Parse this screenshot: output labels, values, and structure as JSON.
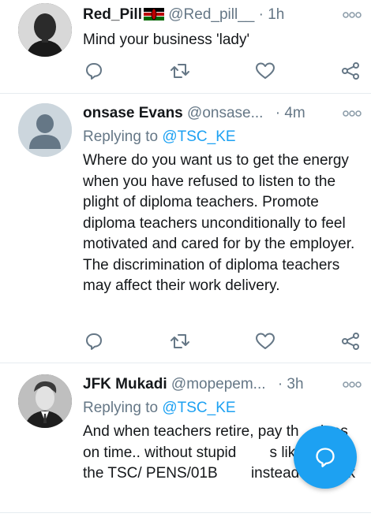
{
  "tweets": [
    {
      "name": "Red_Pill",
      "handle": "@Red_pill__",
      "dot": "·",
      "time": "1h",
      "text": "Mind your business 'lady'",
      "avatar": "man-portrait-bw",
      "flag": "kenya-flag"
    },
    {
      "name": "onsase Evans",
      "handle": "@onsase...",
      "dot": "·",
      "time": "4m",
      "reply_prefix": "Replying to",
      "reply_to": "@TSC_KE",
      "text": "Where do you want us to get the energy when you have refused to listen to the plight of diploma teachers. Promote diploma teachers unconditionally to feel motivated and cared for by the employer. The discrimination of diploma teachers may affect their work delivery.",
      "avatar": "default-avatar"
    },
    {
      "name": "JFK Mukadi",
      "handle": "@mopepem...",
      "dot": "·",
      "time": "3h",
      "reply_prefix": "Replying to",
      "reply_to": "@TSC_KE",
      "text": "And when teachers retire, pay th    dues on time.. without stupid        s like filling the TSC/ PENS/01B        instead of black",
      "avatar": "man-portrait-bw"
    }
  ],
  "icons": {
    "more": "more-dots-icon",
    "reply": "reply-icon",
    "retweet": "retweet-icon",
    "like": "heart-icon",
    "share": "share-icon",
    "compose": "compose-reply-icon"
  },
  "colors": {
    "accent": "#1da1f2",
    "secondary_text": "#657786",
    "icon": "#657786",
    "divider": "#e6ecf0"
  }
}
